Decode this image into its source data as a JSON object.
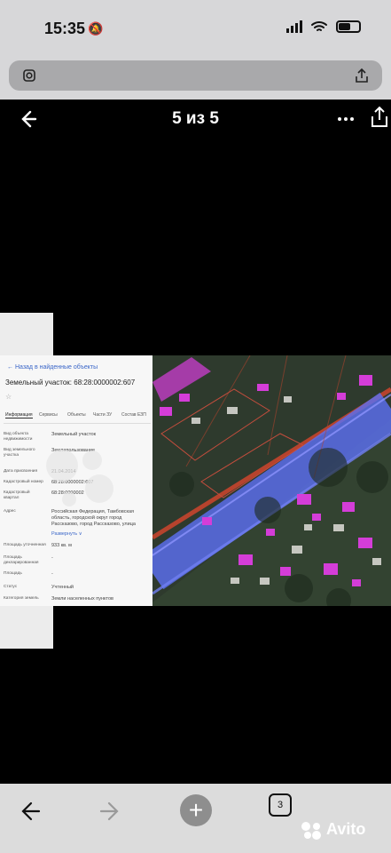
{
  "status": {
    "time": "15:35"
  },
  "viewer": {
    "counter": "5 из 5"
  },
  "document": {
    "back_link": "← Назад в найденные объекты",
    "title": "Земельный участок: 68:28:0000002:607",
    "tabs": [
      "Информация",
      "Сервисы",
      "Объекты",
      "Части ЗУ",
      "Состав ЕЗП"
    ],
    "rows": [
      {
        "label": "Вид объекта недвижимости",
        "value": "Земельный участок"
      },
      {
        "label": "Вид земельного участка",
        "value": "Землепользование"
      },
      {
        "label": "Дата присвоения",
        "value": "21.04.2014"
      },
      {
        "label": "Кадастровый номер",
        "value": "68:28:0000002:607"
      },
      {
        "label": "Кадастровый квартал",
        "value": "68:28:0000002"
      },
      {
        "label": "Адрес",
        "value": "Российская Федерация, Тамбовская область, городской округ город Рассказово, город Рассказово, улица"
      },
      {
        "label": "",
        "value": "Развернуть ∨"
      },
      {
        "label": "Площадь уточненная",
        "value": "933 кв. м"
      },
      {
        "label": "Площадь декларированная",
        "value": "-"
      },
      {
        "label": "Площадь",
        "value": "-"
      },
      {
        "label": "Статус",
        "value": "Учтенный"
      },
      {
        "label": "Категория земель",
        "value": "Земли населенных пунктов"
      }
    ]
  },
  "browser": {
    "tab_count": "3",
    "watermark": "Avito"
  },
  "colors": {
    "status_bg": "#d7d7d9",
    "bottom_bg": "#dcdcdc",
    "map_blue": "#5b6ff0",
    "roof_magenta": "#d43dd8"
  }
}
